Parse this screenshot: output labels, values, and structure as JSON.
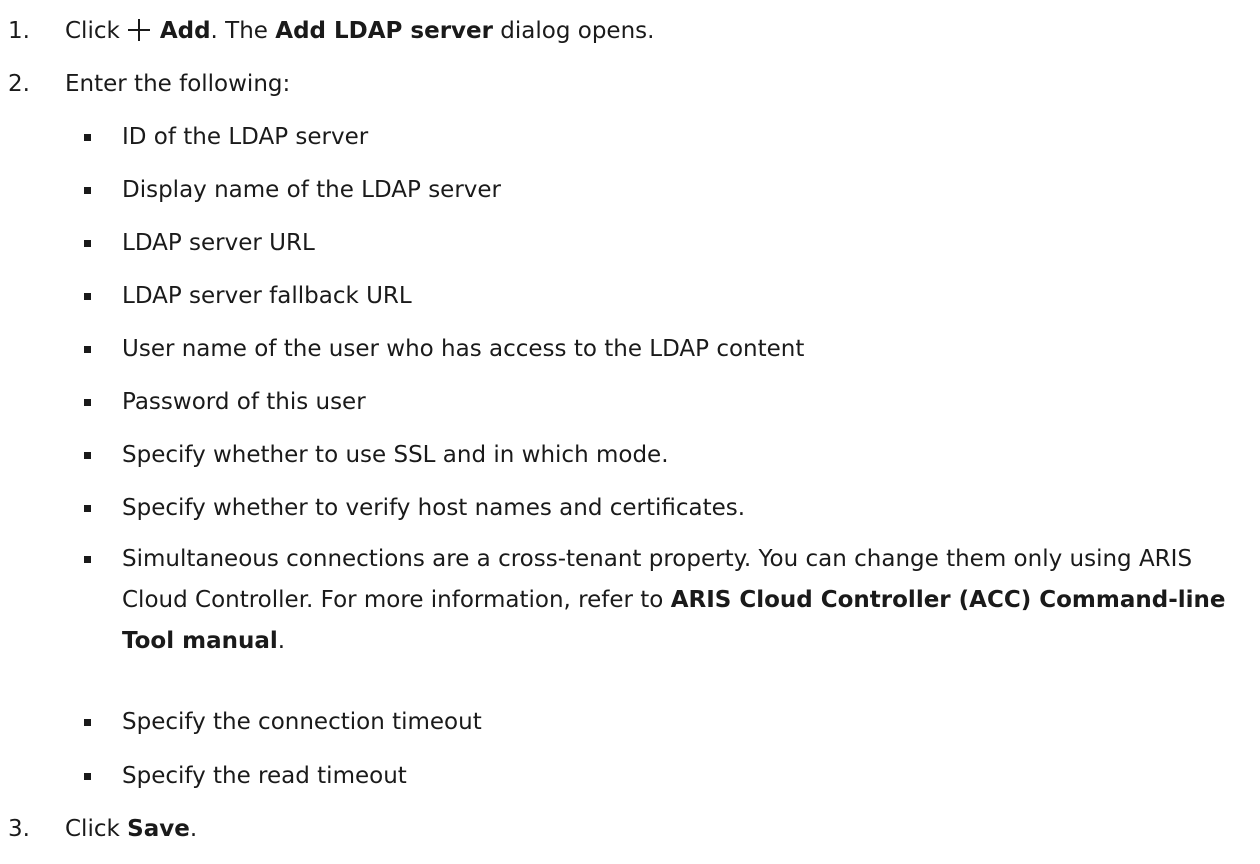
{
  "steps": [
    {
      "number": "1.",
      "click": "Click",
      "add_label": "Add",
      "mid": ". The",
      "dialog_name": "Add LDAP server",
      "end": "dialog opens."
    },
    {
      "number": "2.",
      "text": "Enter the following:"
    },
    {
      "number": "3.",
      "click": "Click",
      "save_label": "Save",
      "end": "."
    }
  ],
  "bullets": [
    "ID of the LDAP server",
    "Display name of the LDAP server",
    "LDAP server URL",
    "LDAP server fallback URL",
    "User name of the user who has access to the LDAP content",
    "Password of this user",
    "Specify whether to use SSL and in which mode.",
    "Specify whether to verify host names and certificates.",
    "Specify the connection timeout",
    "Specify the read timeout"
  ],
  "simultaneous": {
    "text": "Simultaneous connections are a cross-tenant property. You can change them only using ARIS Cloud Controller. For more information, refer to",
    "manual": "ARIS Cloud Controller (ACC) Command-line Tool manual",
    "end": "."
  }
}
